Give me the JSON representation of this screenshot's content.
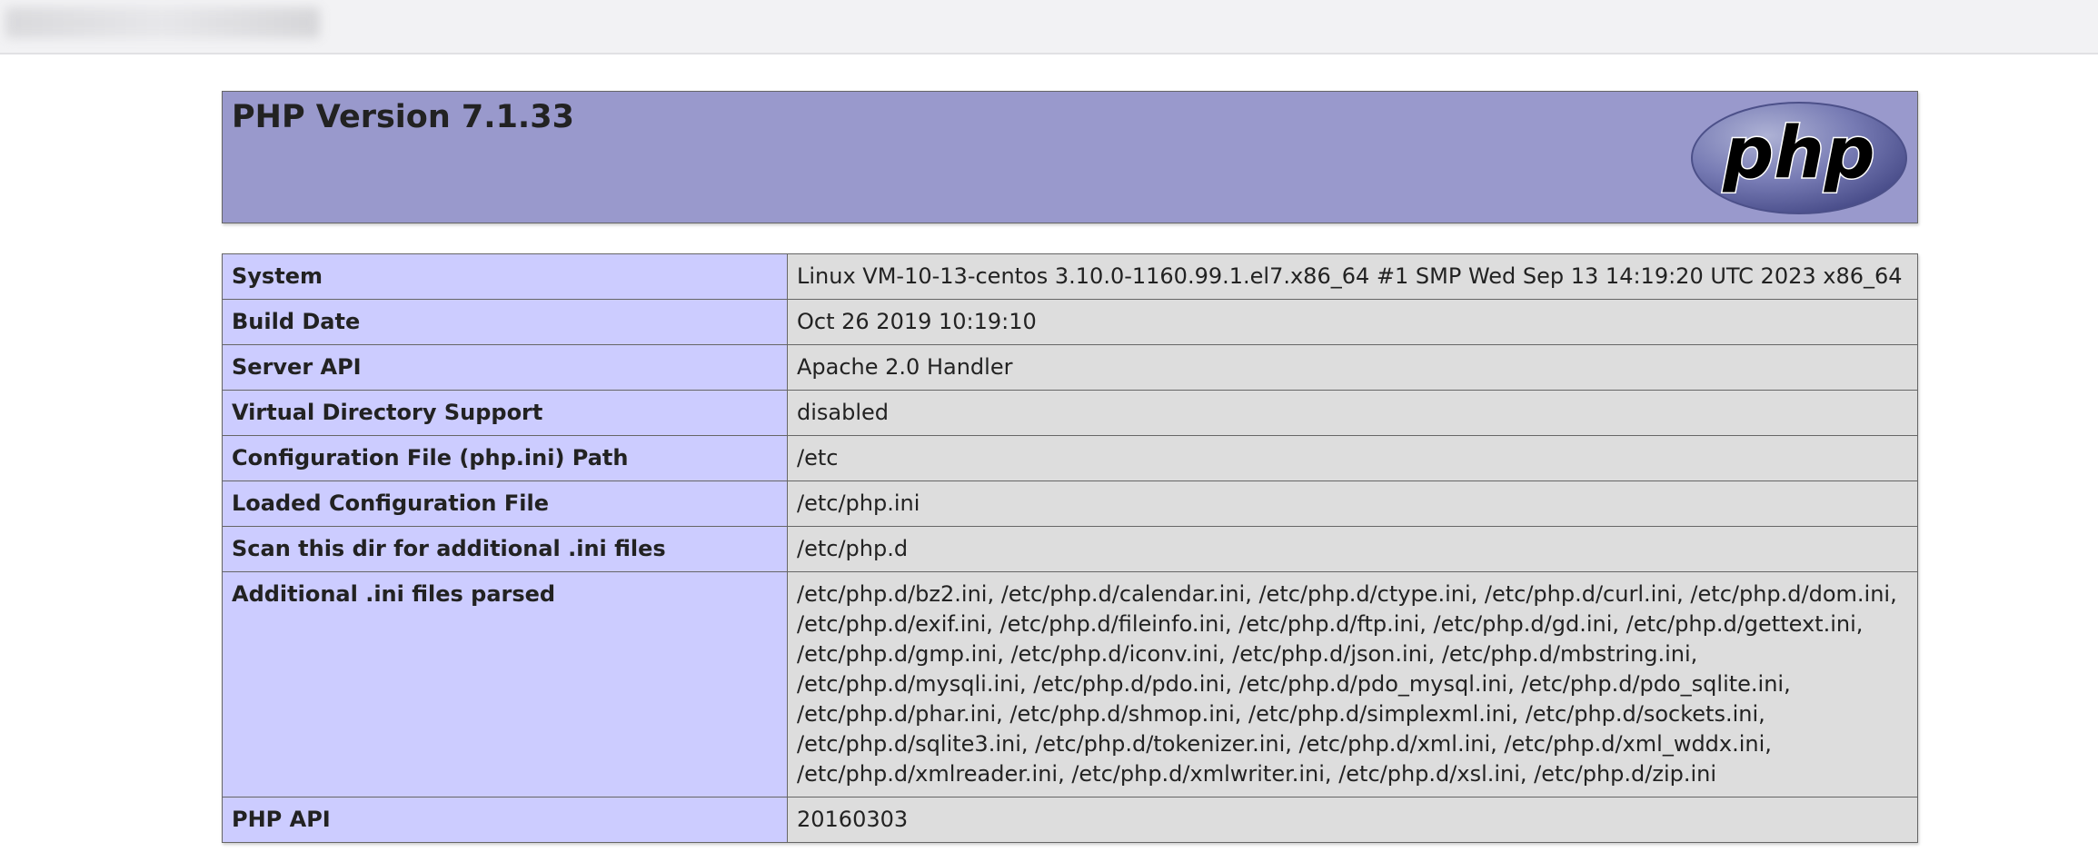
{
  "header": {
    "title": "PHP Version 7.1.33",
    "logo_text": "php"
  },
  "colors": {
    "header_bg": "#9999cc",
    "key_bg": "#ccccff",
    "value_bg": "#dddddd",
    "border": "#666666"
  },
  "rows": [
    {
      "key": "System",
      "value": "Linux VM-10-13-centos 3.10.0-1160.99.1.el7.x86_64 #1 SMP Wed Sep 13 14:19:20 UTC 2023 x86_64"
    },
    {
      "key": "Build Date",
      "value": "Oct 26 2019 10:19:10"
    },
    {
      "key": "Server API",
      "value": "Apache 2.0 Handler"
    },
    {
      "key": "Virtual Directory Support",
      "value": "disabled"
    },
    {
      "key": "Configuration File (php.ini) Path",
      "value": "/etc"
    },
    {
      "key": "Loaded Configuration File",
      "value": "/etc/php.ini"
    },
    {
      "key": "Scan this dir for additional .ini files",
      "value": "/etc/php.d"
    },
    {
      "key": "Additional .ini files parsed",
      "value": "/etc/php.d/bz2.ini, /etc/php.d/calendar.ini, /etc/php.d/ctype.ini, /etc/php.d/curl.ini, /etc/php.d/dom.ini, /etc/php.d/exif.ini, /etc/php.d/fileinfo.ini, /etc/php.d/ftp.ini, /etc/php.d/gd.ini, /etc/php.d/gettext.ini, /etc/php.d/gmp.ini, /etc/php.d/iconv.ini, /etc/php.d/json.ini, /etc/php.d/mbstring.ini, /etc/php.d/mysqli.ini, /etc/php.d/pdo.ini, /etc/php.d/pdo_mysql.ini, /etc/php.d/pdo_sqlite.ini, /etc/php.d/phar.ini, /etc/php.d/shmop.ini, /etc/php.d/simplexml.ini, /etc/php.d/sockets.ini, /etc/php.d/sqlite3.ini, /etc/php.d/tokenizer.ini, /etc/php.d/xml.ini, /etc/php.d/xml_wddx.ini, /etc/php.d/xmlreader.ini, /etc/php.d/xmlwriter.ini, /etc/php.d/xsl.ini, /etc/php.d/zip.ini"
    },
    {
      "key": "PHP API",
      "value": "20160303"
    }
  ]
}
